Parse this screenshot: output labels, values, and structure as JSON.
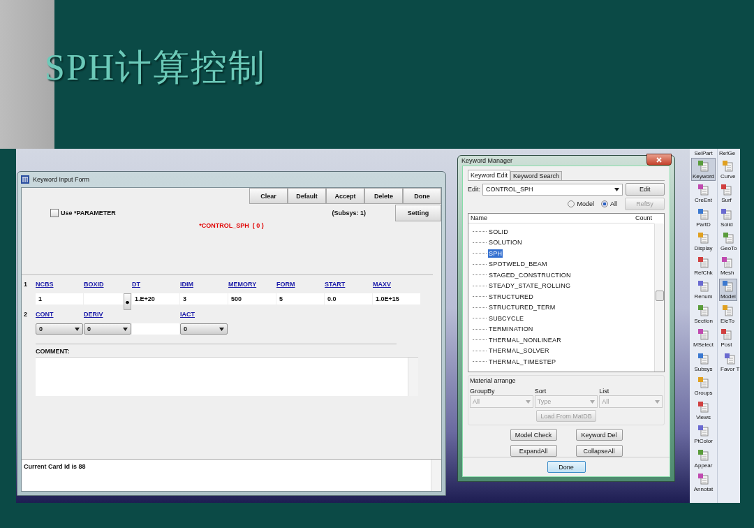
{
  "slide": {
    "title": "SPH计算控制"
  },
  "keyword_input_form": {
    "title": "Keyword Input Form",
    "buttons": [
      "Clear",
      "Default",
      "Accept",
      "Delete",
      "Done"
    ],
    "use_parameter": {
      "label": "Use *PARAMETER",
      "checked": false
    },
    "subsys": "(Subsys: 1)",
    "setting_button": "Setting",
    "keyword": "*CONTROL_SPH  ( 0 )",
    "cards": [
      {
        "number": "1",
        "fields": [
          {
            "label": "NCBS",
            "kind": "text",
            "value": "1"
          },
          {
            "label": "BOXID",
            "kind": "picker"
          },
          {
            "label": "DT",
            "kind": "text",
            "value": "1.E+20"
          },
          {
            "label": "IDIM",
            "kind": "text",
            "value": "3"
          },
          {
            "label": "MEMORY",
            "kind": "text",
            "value": "500"
          },
          {
            "label": "FORM",
            "kind": "text",
            "value": "5"
          },
          {
            "label": "START",
            "kind": "text",
            "value": "0.0"
          },
          {
            "label": "MAXV",
            "kind": "text",
            "value": "1.0E+15"
          }
        ]
      },
      {
        "number": "2",
        "fields": [
          {
            "label": "CONT",
            "kind": "select",
            "value": "0"
          },
          {
            "label": "DERIV",
            "kind": "select",
            "value": "0"
          },
          {
            "kind": "text"
          },
          {
            "label": "IACT",
            "kind": "select",
            "value": "0"
          }
        ]
      }
    ],
    "comment_label": "COMMENT:",
    "status": "Current Card Id is 88"
  },
  "keyword_manager": {
    "title": "Keyword Manager",
    "tabs": [
      {
        "label": "Keyword Edit",
        "selected": true
      },
      {
        "label": "Keyword Search",
        "selected": false
      }
    ],
    "edit_label": "Edit:",
    "edit_value": "CONTROL_SPH",
    "edit_button": "Edit",
    "scope": [
      {
        "label": "Model",
        "selected": false
      },
      {
        "label": "All",
        "selected": true
      }
    ],
    "refby_button": {
      "label": "RefBy",
      "disabled": true
    },
    "list_columns": [
      "Name",
      "Count"
    ],
    "items": [
      {
        "label": "SOLID",
        "selected": false
      },
      {
        "label": "SOLUTION",
        "selected": false
      },
      {
        "label": "SPH",
        "selected": true
      },
      {
        "label": "SPOTWELD_BEAM",
        "selected": false
      },
      {
        "label": "STAGED_CONSTRUCTION",
        "selected": false
      },
      {
        "label": "STEADY_STATE_ROLLING",
        "selected": false
      },
      {
        "label": "STRUCTURED",
        "selected": false
      },
      {
        "label": "STRUCTURED_TERM",
        "selected": false
      },
      {
        "label": "SUBCYCLE",
        "selected": false
      },
      {
        "label": "TERMINATION",
        "selected": false
      },
      {
        "label": "THERMAL_NONLINEAR",
        "selected": false
      },
      {
        "label": "THERMAL_SOLVER",
        "selected": false
      },
      {
        "label": "THERMAL_TIMESTEP",
        "selected": false
      }
    ],
    "material_arrange": {
      "title": "Material arrange",
      "disabled": true,
      "selects": [
        {
          "label": "GroupBy",
          "value": "All"
        },
        {
          "label": "Sort",
          "value": "Type"
        },
        {
          "label": "List",
          "value": "All"
        }
      ],
      "load_button": "Load From MatDB"
    },
    "action_buttons": [
      "Model Check",
      "Keyword Del",
      "ExpandAll",
      "CollapseAll"
    ],
    "done_button": "Done"
  },
  "toolbar": {
    "columns": [
      {
        "header": "SelPart",
        "items": [
          {
            "label": "Keyword",
            "selected": true
          },
          {
            "label": "CreEnt",
            "selected": false
          },
          {
            "label": "PartD",
            "selected": false
          },
          {
            "label": "Display",
            "selected": false
          },
          {
            "label": "RefChk",
            "selected": false
          },
          {
            "label": "Renum",
            "selected": false
          },
          {
            "label": "Section",
            "selected": false
          },
          {
            "label": "MSelect",
            "selected": false
          },
          {
            "label": "Subsys",
            "selected": false
          },
          {
            "label": "Groups",
            "selected": false
          },
          {
            "label": "Views",
            "selected": false
          },
          {
            "label": "PtColor",
            "selected": false
          },
          {
            "label": "Appear",
            "selected": false
          },
          {
            "label": "Annotat",
            "selected": false
          }
        ]
      },
      {
        "header": "RefGe",
        "items": [
          {
            "label": "Curve",
            "selected": false
          },
          {
            "label": "Surf",
            "selected": false
          },
          {
            "label": "Solid",
            "selected": false
          },
          {
            "label": "GeoTo",
            "selected": false
          },
          {
            "label": "Mesh",
            "selected": false
          },
          {
            "label": "Model",
            "selected": true
          },
          {
            "label": "EleTo",
            "selected": false
          },
          {
            "label": "Post",
            "selected": false
          },
          {
            "label": "Favor T",
            "selected": false
          }
        ]
      }
    ]
  }
}
